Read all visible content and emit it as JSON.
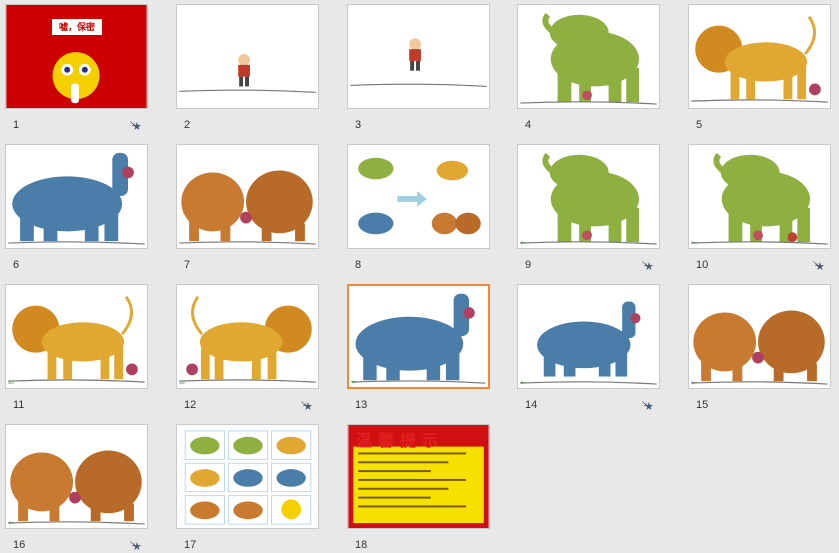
{
  "slides": [
    {
      "number": "1",
      "kind": "secret",
      "title": "嘘，保密",
      "has_animation": true
    },
    {
      "number": "2",
      "kind": "boy",
      "has_animation": false
    },
    {
      "number": "3",
      "kind": "boy2",
      "has_animation": false
    },
    {
      "number": "4",
      "kind": "elephant",
      "has_animation": false
    },
    {
      "number": "5",
      "kind": "lion",
      "has_animation": false
    },
    {
      "number": "6",
      "kind": "hippo",
      "has_animation": false
    },
    {
      "number": "7",
      "kind": "bears",
      "has_animation": false
    },
    {
      "number": "8",
      "kind": "collage",
      "has_animation": false
    },
    {
      "number": "9",
      "kind": "elephant",
      "has_animation": true
    },
    {
      "number": "10",
      "kind": "elephant2",
      "has_animation": true
    },
    {
      "number": "11",
      "kind": "lion",
      "has_animation": false
    },
    {
      "number": "12",
      "kind": "lion2",
      "has_animation": true
    },
    {
      "number": "13",
      "kind": "hippo",
      "has_animation": false,
      "selected": true
    },
    {
      "number": "14",
      "kind": "hippo2",
      "has_animation": true
    },
    {
      "number": "15",
      "kind": "bears",
      "has_animation": false
    },
    {
      "number": "16",
      "kind": "bears2",
      "has_animation": true
    },
    {
      "number": "17",
      "kind": "grid",
      "has_animation": false
    },
    {
      "number": "18",
      "kind": "tips",
      "title": "温馨提示",
      "has_animation": false
    }
  ],
  "icons": {
    "animation": "star-icon",
    "transition": "arrow-icon"
  },
  "colors": {
    "selected_border": "#f08a3a",
    "elephant": "#8db040",
    "lion": "#e0a830",
    "hippo": "#4a7ea8",
    "bear": "#c87a30",
    "secret_bg": "#cc0000",
    "tips_bg": "#f5e000",
    "tips_border": "#d01010"
  }
}
